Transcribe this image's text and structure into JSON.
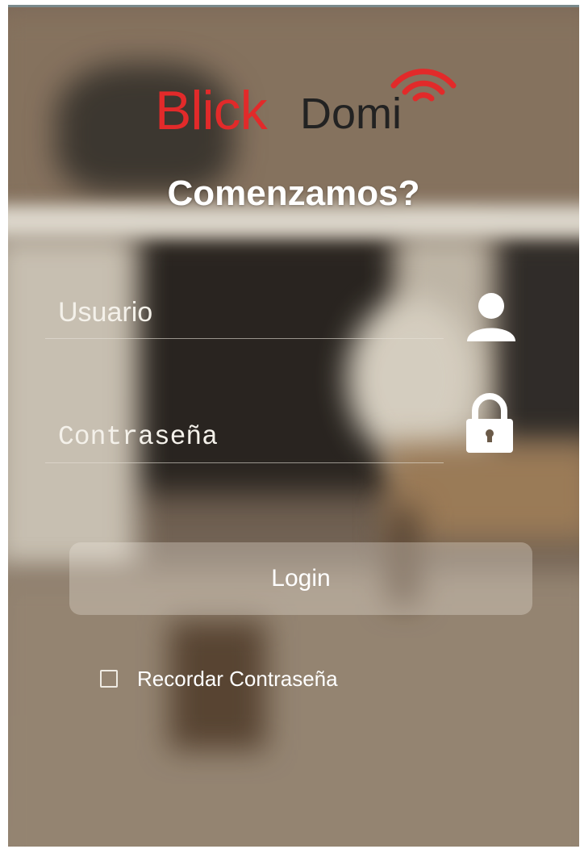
{
  "app": {
    "logo": {
      "part_primary": "Blick",
      "part_secondary": "Domi",
      "colors": {
        "primary": "#e22a2a",
        "secondary": "#222222"
      },
      "icon": "wifi-signal-icon"
    },
    "headline": "Comenzamos?"
  },
  "form": {
    "username": {
      "placeholder": "Usuario",
      "value": "",
      "icon": "user-icon"
    },
    "password": {
      "placeholder": "Contraseña",
      "value": "",
      "icon": "lock-icon"
    },
    "login_button": {
      "label": "Login"
    },
    "remember": {
      "label": "Recordar Contraseña",
      "checked": false
    }
  },
  "colors": {
    "text": "#ffffff",
    "button_bg": "rgba(240,234,224,0.32)",
    "logo_red": "#e22a2a"
  }
}
